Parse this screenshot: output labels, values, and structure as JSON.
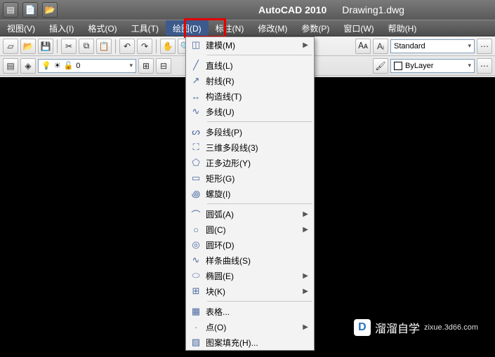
{
  "title": {
    "app": "AutoCAD 2010",
    "doc": "Drawing1.dwg"
  },
  "menubar": [
    "视图(V)",
    "插入(I)",
    "格式(O)",
    "工具(T)",
    "绘图(D)",
    "标注(N)",
    "修改(M)",
    "参数(P)",
    "窗口(W)",
    "帮助(H)"
  ],
  "active_menu_index": 4,
  "toolbar": {
    "style_combo": "Standard",
    "layer_combo": "ByLayer",
    "layer_field": "0"
  },
  "dropdown": {
    "groups": [
      [
        {
          "icon": "◫",
          "label": "建模(M)",
          "sub": true
        }
      ],
      [
        {
          "icon": "╱",
          "label": "直线(L)"
        },
        {
          "icon": "↗",
          "label": "射线(R)"
        },
        {
          "icon": "↔",
          "label": "构造线(T)"
        },
        {
          "icon": "∿",
          "label": "多线(U)"
        }
      ],
      [
        {
          "icon": "ᔕ",
          "label": "多段线(P)"
        },
        {
          "icon": "⛶",
          "label": "三维多段线(3)"
        },
        {
          "icon": "⬠",
          "label": "正多边形(Y)"
        },
        {
          "icon": "▭",
          "label": "矩形(G)"
        },
        {
          "icon": "꩜",
          "label": "螺旋(I)"
        }
      ],
      [
        {
          "icon": "⌒",
          "label": "圆弧(A)",
          "sub": true
        },
        {
          "icon": "○",
          "label": "圆(C)",
          "sub": true
        },
        {
          "icon": "◎",
          "label": "圆环(D)"
        },
        {
          "icon": "∿",
          "label": "样条曲线(S)"
        },
        {
          "icon": "⬭",
          "label": "椭圆(E)",
          "sub": true
        },
        {
          "icon": "⊞",
          "label": "块(K)",
          "sub": true
        }
      ],
      [
        {
          "icon": "▦",
          "label": "表格...",
          "text_only": false
        },
        {
          "icon": "·",
          "label": "点(O)",
          "sub": true
        },
        {
          "icon": "▨",
          "label": "图案填充(H)..."
        }
      ]
    ]
  },
  "watermark": {
    "text": "溜溜自学",
    "sub": "zixue.3d66.com",
    "logo": "D"
  }
}
